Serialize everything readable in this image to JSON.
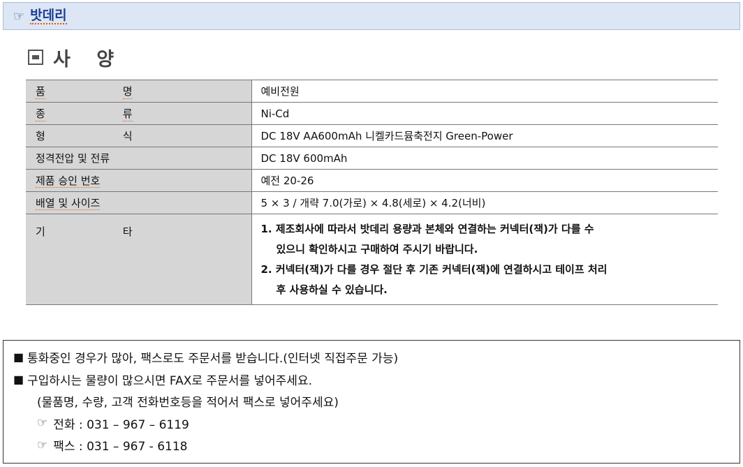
{
  "header": {
    "pointer_icon": "☞",
    "title": "밧데리"
  },
  "section": {
    "title": "사 양"
  },
  "spec_table": {
    "rows": [
      {
        "label": "품명",
        "label_parts": [
          "품",
          "명"
        ],
        "value": "예비전원"
      },
      {
        "label": "종류",
        "label_parts": [
          "종",
          "류"
        ],
        "value": "Ni-Cd"
      },
      {
        "label": "형식",
        "label_parts": [
          "형",
          "식"
        ],
        "value": "DC 18V AA600mAh 니켈카드뮴축전지 Green-Power"
      },
      {
        "label": "정격전압 및 전류",
        "value": "DC 18V 600mAh"
      },
      {
        "label": "제품 승인 번호",
        "value": "예전 20-26"
      },
      {
        "label": "배열 및 사이즈",
        "value": "5 × 3   /   개략 7.0(가로) × 4.8(세로) × 4.2(너비)"
      },
      {
        "label": "기타",
        "label_parts": [
          "기",
          "타"
        ]
      }
    ],
    "notes": [
      {
        "first": "1. 제조회사에 따라서 밧데리 용량과 본체와 연결하는 커넥터(잭)가 다를 수",
        "second": "있으니 확인하시고 구매하여 주시기 바랍니다."
      },
      {
        "first": "2. 커넥터(잭)가 다를 경우 절단 후 기존 커넥터(잭)에 연결하시고 테이프 처리",
        "second": "후 사용하실 수 있습니다."
      }
    ]
  },
  "order_info": {
    "bullet_icon": "■",
    "line1": "통화중인 경우가 많아, 팩스로도 주문서를 받습니다.(인터넷 직접주문 가능)",
    "line2": "구입하시는 물량이 많으시면 FAX로 주문서를 넣어주세요.",
    "line3": "(물품명, 수량, 고객 전화번호등을 적어서 팩스로 넣어주세요)",
    "phone": "전화 : 031 – 967 – 6119",
    "fax": "팩스 : 031 – 967 - 6118",
    "hand_icon": "☞"
  }
}
